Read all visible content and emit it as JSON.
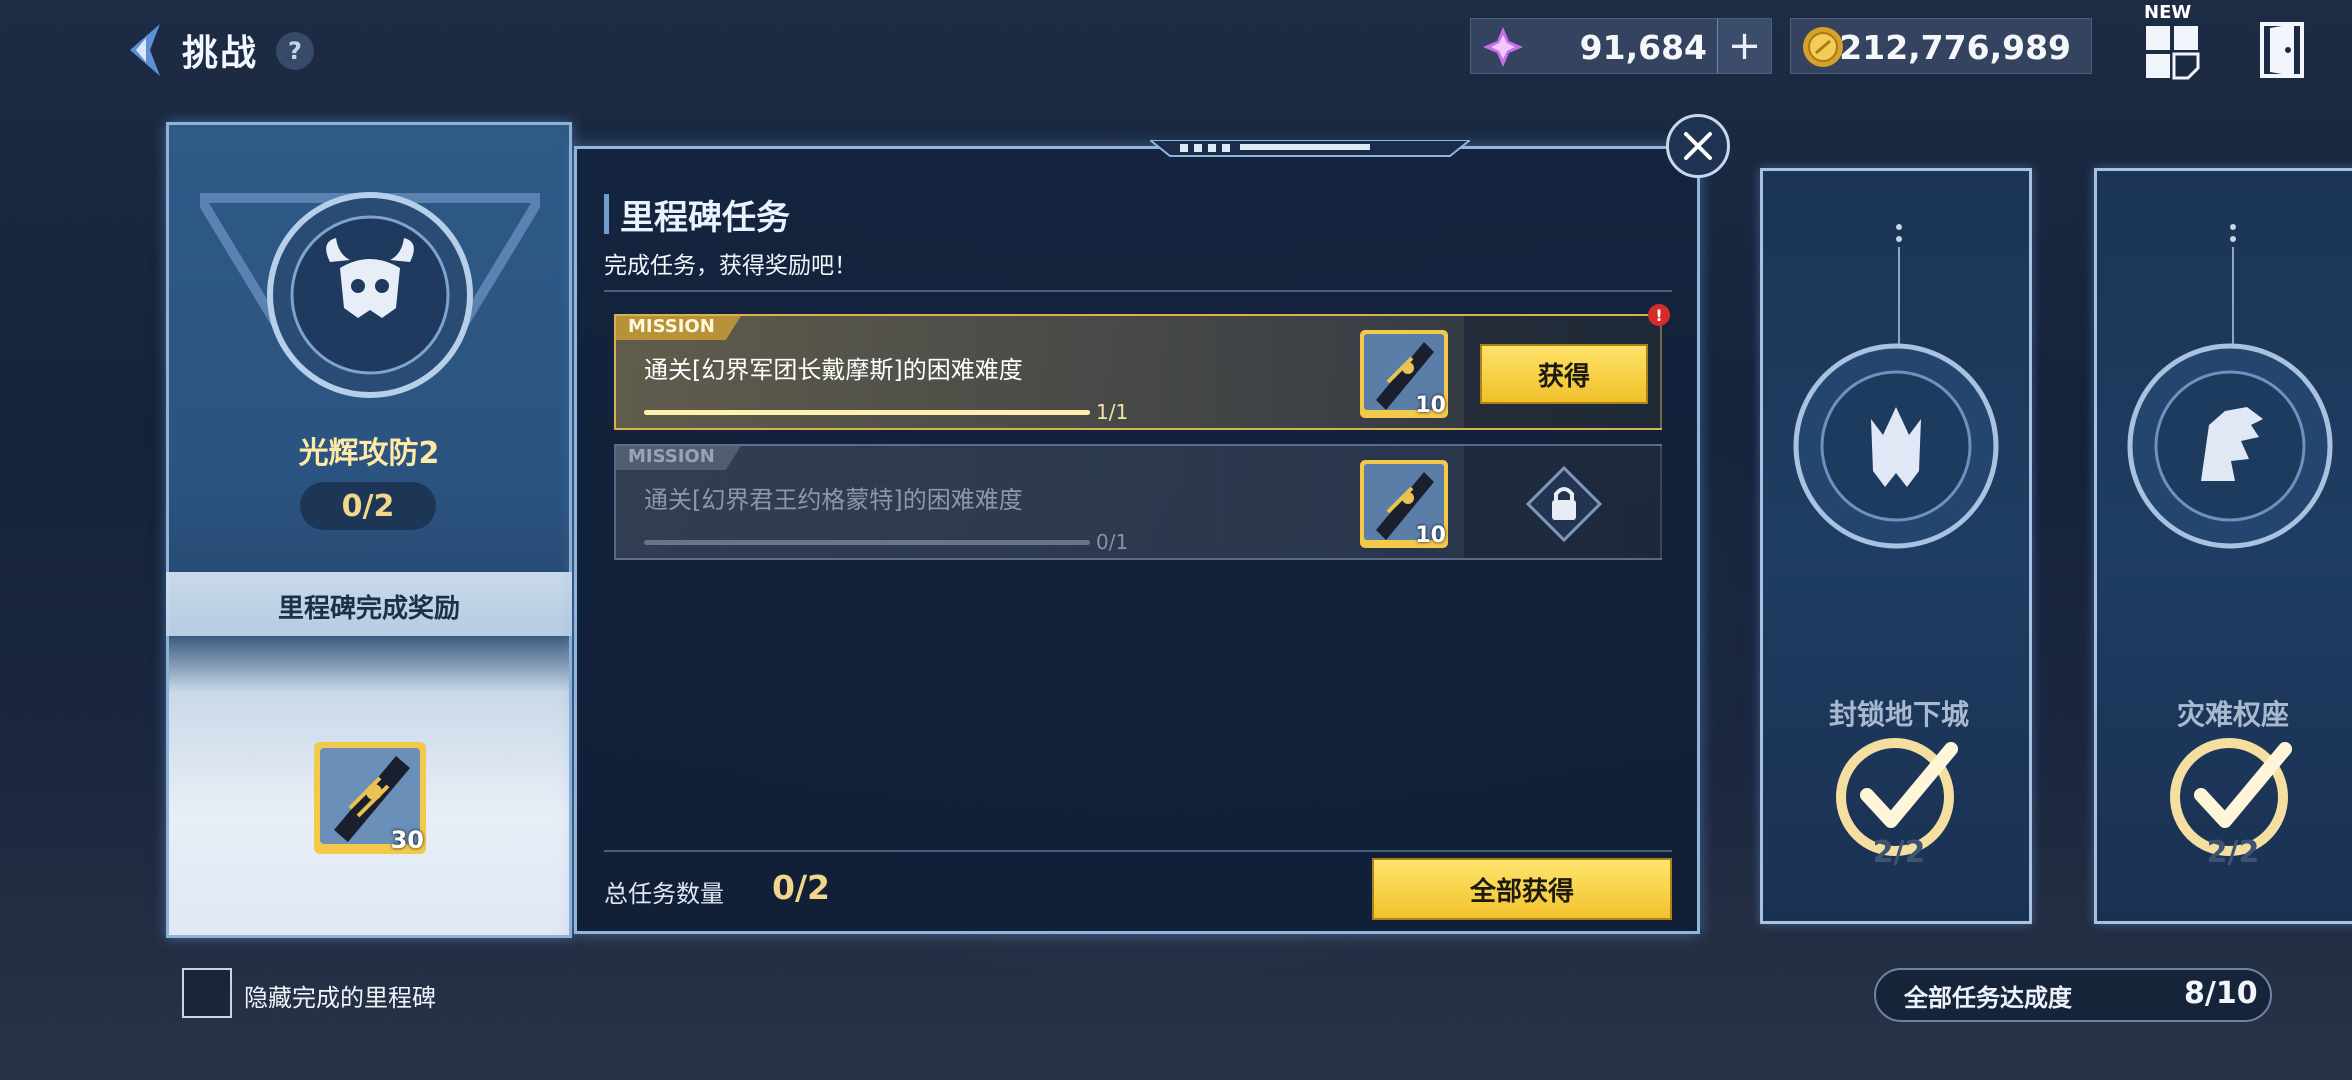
{
  "header": {
    "title": "挑战",
    "help_label": "?",
    "back_icon": "chevron-left-icon",
    "currencies": [
      {
        "icon": "crystal-icon",
        "value": "91,684",
        "has_plus": true,
        "plus_label": "+"
      },
      {
        "icon": "gold-coin-icon",
        "value": "212,776,989"
      }
    ],
    "menu_badge": "NEW",
    "menu_icon": "grid-menu-icon",
    "exit_icon": "exit-door-icon"
  },
  "left_panel": {
    "stage_name": "光辉攻防2",
    "stage_count": "0/2",
    "reward_title": "里程碑完成奖励",
    "reward_item": {
      "icon": "golden-ticket-icon",
      "quantity": "30"
    }
  },
  "dialog": {
    "title": "里程碑任务",
    "subtitle": "完成任务，获得奖励吧！",
    "missions": [
      {
        "tag": "MISSION",
        "name": "通关[幻界军团长戴摩斯]的困难难度",
        "progress_text": "1/1",
        "progress": 1.0,
        "reward_qty": "10",
        "state": "claimable",
        "button_label": "获得",
        "alert": "!"
      },
      {
        "tag": "MISSION",
        "name": "通关[幻界君王约格蒙特]的困难难度",
        "progress_text": "0/1",
        "progress": 0.0,
        "reward_qty": "10",
        "state": "locked"
      }
    ],
    "total_label": "总任务数量",
    "total_value": "0/2",
    "claim_all_label": "全部获得"
  },
  "cards": [
    {
      "name": "封锁地下城",
      "count": "2/2",
      "completed": true
    },
    {
      "name": "灾难权座",
      "count": "2/2",
      "completed": true
    }
  ],
  "footer": {
    "hide_completed_label": "隐藏完成的里程碑",
    "overall_label": "全部任务达成度",
    "overall_value": "8/10"
  },
  "colors": {
    "gold_button": "#f0c02a",
    "gold_text": "#f2d68e",
    "panel_border": "#8fb6dd",
    "alert_red": "#d62b2b"
  }
}
